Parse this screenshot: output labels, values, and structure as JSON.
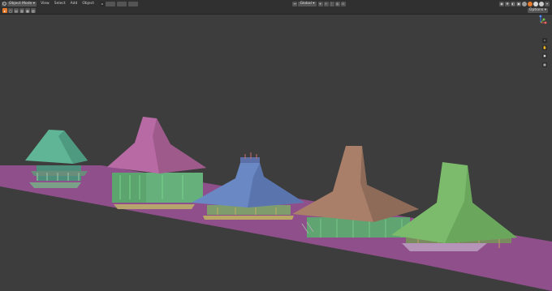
{
  "header": {
    "mode_label": "Object Mode",
    "menus": [
      "View",
      "Select",
      "Add",
      "Object"
    ],
    "transform_orientation": "Global"
  },
  "overlay": {
    "options_label": "Options"
  },
  "gizmo": {
    "axes": [
      "Z",
      "Y",
      "X"
    ]
  },
  "icons": {
    "editor_type": "cube-icon",
    "move_view": "hand-icon",
    "zoom": "magnifier-icon",
    "camera": "camera-icon",
    "perspective": "grid-icon"
  },
  "colors": {
    "viewport": "#3d3d3d",
    "header": "#303030",
    "ground": "#8f4f8b",
    "roof_teal": "#5fb596",
    "roof_pink": "#b86aa4",
    "roof_blue": "#6a88c4",
    "roof_brown": "#a97f69",
    "roof_green": "#7cbb6c",
    "walls_green": "#69b77f",
    "accent": "#e57a2c"
  }
}
